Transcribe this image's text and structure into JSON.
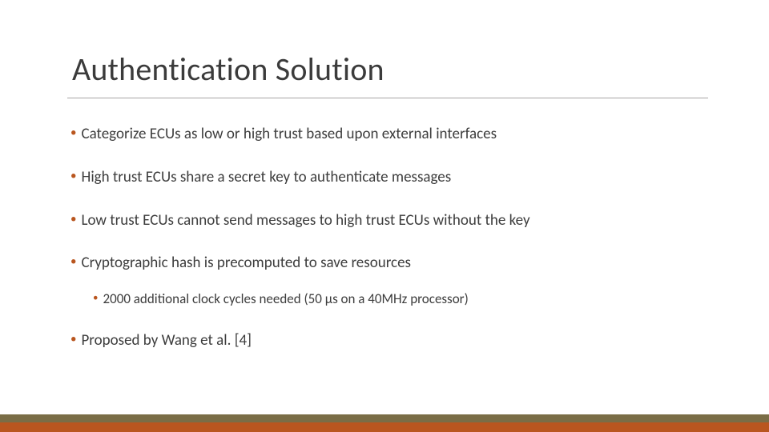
{
  "title": "Authentication Solution",
  "bullets": {
    "b1": "Categorize ECUs as low or high trust based upon external interfaces",
    "b2": "High trust ECUs share a secret key to authenticate messages",
    "b3": "Low trust ECUs cannot send messages to high trust ECUs without the key",
    "b4": "Cryptographic hash is precomputed to save resources",
    "b4sub": "2000 additional clock cycles needed (50 μs on a 40MHz processor)",
    "b5": "Proposed by Wang et al. [4]"
  }
}
